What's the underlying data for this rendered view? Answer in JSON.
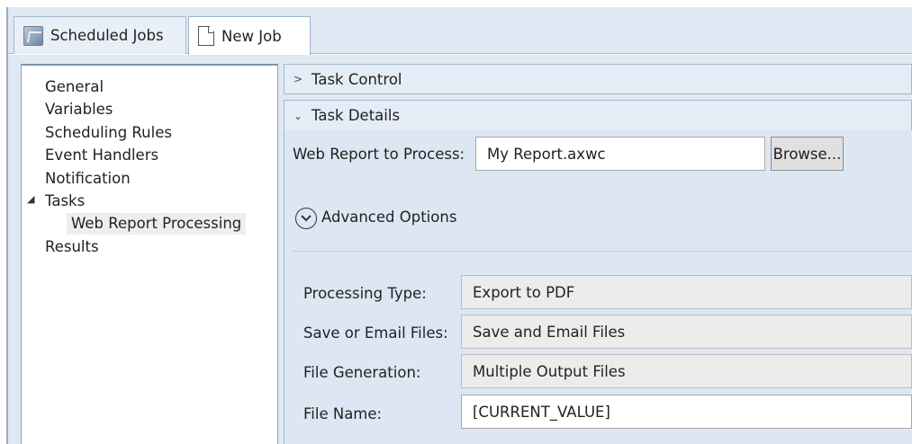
{
  "tabs": [
    {
      "label": "Scheduled Jobs",
      "icon": "calendar-icon",
      "active": false
    },
    {
      "label": "New Job",
      "icon": "document-icon",
      "active": true
    }
  ],
  "tree": {
    "items": [
      {
        "label": "General"
      },
      {
        "label": "Variables"
      },
      {
        "label": "Scheduling Rules"
      },
      {
        "label": "Event Handlers"
      },
      {
        "label": "Notification"
      },
      {
        "label": "Tasks",
        "expanded": true
      },
      {
        "label": "Web Report Processing",
        "selected": true
      },
      {
        "label": "Results"
      }
    ]
  },
  "sections": {
    "task_control": {
      "title": "Task Control",
      "expanded": false
    },
    "task_details": {
      "title": "Task Details",
      "expanded": true
    }
  },
  "details": {
    "web_report_label": "Web Report to Process:",
    "web_report_value": "My Report.axwc",
    "browse_label": "Browse...",
    "advanced_label": "Advanced Options",
    "processing_type_label": "Processing Type:",
    "processing_type_value": "Export to PDF",
    "save_email_label": "Save or Email Files:",
    "save_email_value": "Save and Email Files",
    "file_generation_label": "File Generation:",
    "file_generation_value": "Multiple Output Files",
    "file_name_label": "File Name:",
    "file_name_value": "[CURRENT_VALUE]"
  },
  "colors": {
    "panel_bg": "#dfe8f3",
    "header_bg": "#e4ecf6",
    "border": "#a6b9cd"
  }
}
